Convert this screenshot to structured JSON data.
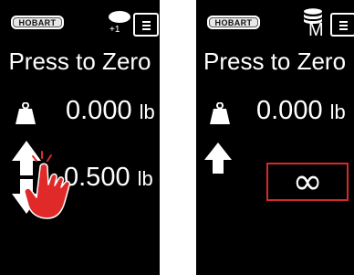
{
  "left_screen": {
    "brand": "HOBART",
    "count_badge": "+1",
    "title": "Press to Zero",
    "weight_value": "0.000",
    "weight_unit": "lb",
    "increment_value": "0.500",
    "increment_unit": "lb"
  },
  "right_screen": {
    "brand": "HOBART",
    "mode_letter": "M",
    "title": "Press to Zero",
    "weight_value": "0.000",
    "weight_unit": "lb",
    "increment_symbol": "∞"
  },
  "colors": {
    "screen_bg": "#000000",
    "text": "#ffffff",
    "highlight_red": "#d32a2a",
    "hand_red": "#e02a2a"
  }
}
